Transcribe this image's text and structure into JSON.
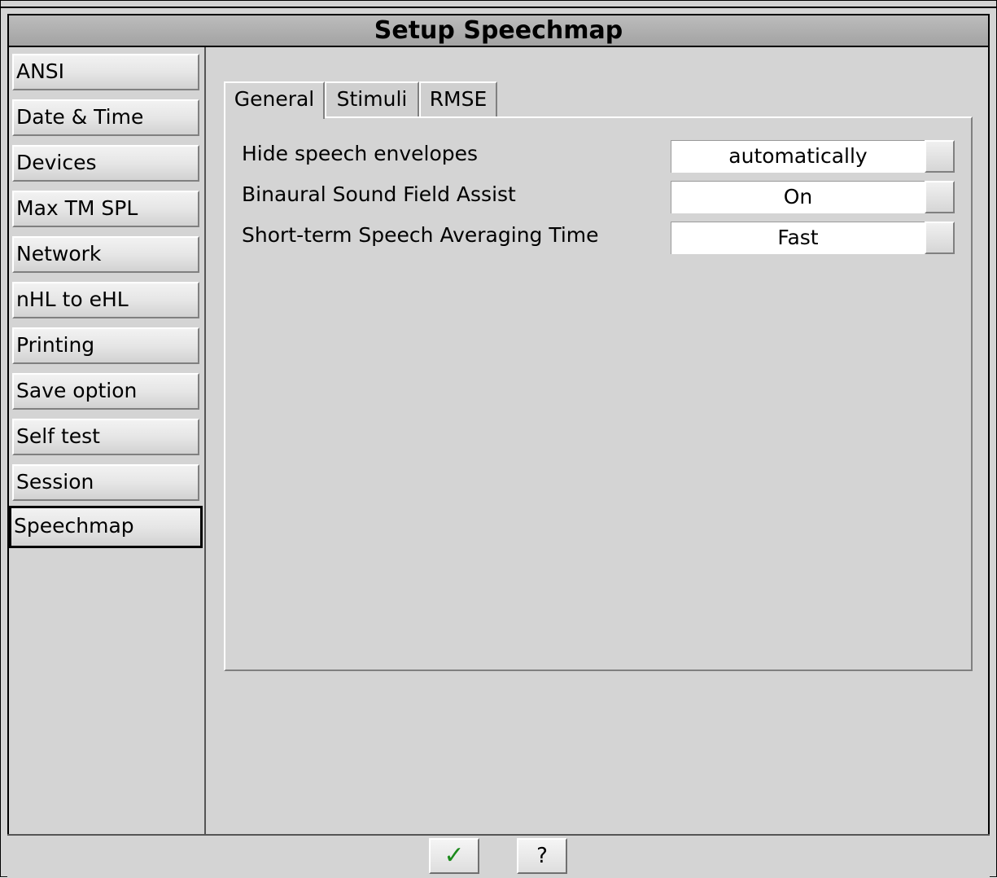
{
  "window": {
    "title": "Setup Speechmap"
  },
  "sidebar": {
    "items": [
      {
        "label": "ANSI"
      },
      {
        "label": "Date & Time"
      },
      {
        "label": "Devices"
      },
      {
        "label": "Max TM SPL"
      },
      {
        "label": "Network"
      },
      {
        "label": "nHL to eHL"
      },
      {
        "label": "Printing"
      },
      {
        "label": "Save option"
      },
      {
        "label": "Self test"
      },
      {
        "label": "Session"
      },
      {
        "label": "Speechmap"
      }
    ],
    "selected": "Speechmap"
  },
  "tabs": [
    {
      "label": "General"
    },
    {
      "label": "Stimuli"
    },
    {
      "label": "RMSE"
    }
  ],
  "active_tab": "General",
  "settings": [
    {
      "label": "Hide speech envelopes",
      "value": "automatically"
    },
    {
      "label": "Binaural Sound Field Assist",
      "value": "On"
    },
    {
      "label": "Short-term Speech Averaging Time",
      "value": "Fast"
    }
  ],
  "footer": {
    "ok_icon": "check-icon",
    "help_label": "?"
  }
}
